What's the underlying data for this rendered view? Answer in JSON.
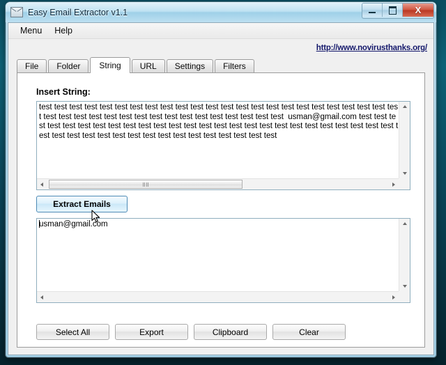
{
  "window": {
    "title": "Easy Email Extractor v1.1",
    "icon": "envelope-icon",
    "controls": {
      "minimize": "–",
      "maximize": "□",
      "close": "X"
    }
  },
  "menubar": {
    "items": [
      {
        "label": "Menu"
      },
      {
        "label": "Help"
      }
    ]
  },
  "link": {
    "label": "http://www.novirusthanks.org/",
    "color": "#14186b"
  },
  "tabs": {
    "active": "String",
    "items": [
      {
        "label": "File"
      },
      {
        "label": "Folder"
      },
      {
        "label": "String"
      },
      {
        "label": "URL"
      },
      {
        "label": "Settings"
      },
      {
        "label": "Filters"
      }
    ]
  },
  "main": {
    "insert_label": "Insert String:",
    "input": {
      "value": "test test test test test test test test test test test test test test test test test test test test test test test test test test test test test test test test test test test test test test test test  usman@gmail.com test test test test test test test test test test test test test test test test test test test test test test test test test test test test test test test test test test test test test test test test test test"
    },
    "extract_button": {
      "label": "Extract Emails"
    },
    "result": {
      "value": "usman@gmail.com"
    },
    "buttons": [
      {
        "label": "Select All"
      },
      {
        "label": "Export"
      },
      {
        "label": "Clipboard"
      },
      {
        "label": "Clear"
      }
    ]
  },
  "scrollbars": {
    "up": "scroll-up-arrow",
    "down": "scroll-down-arrow",
    "left": "scroll-left-arrow",
    "right": "scroll-right-arrow"
  }
}
